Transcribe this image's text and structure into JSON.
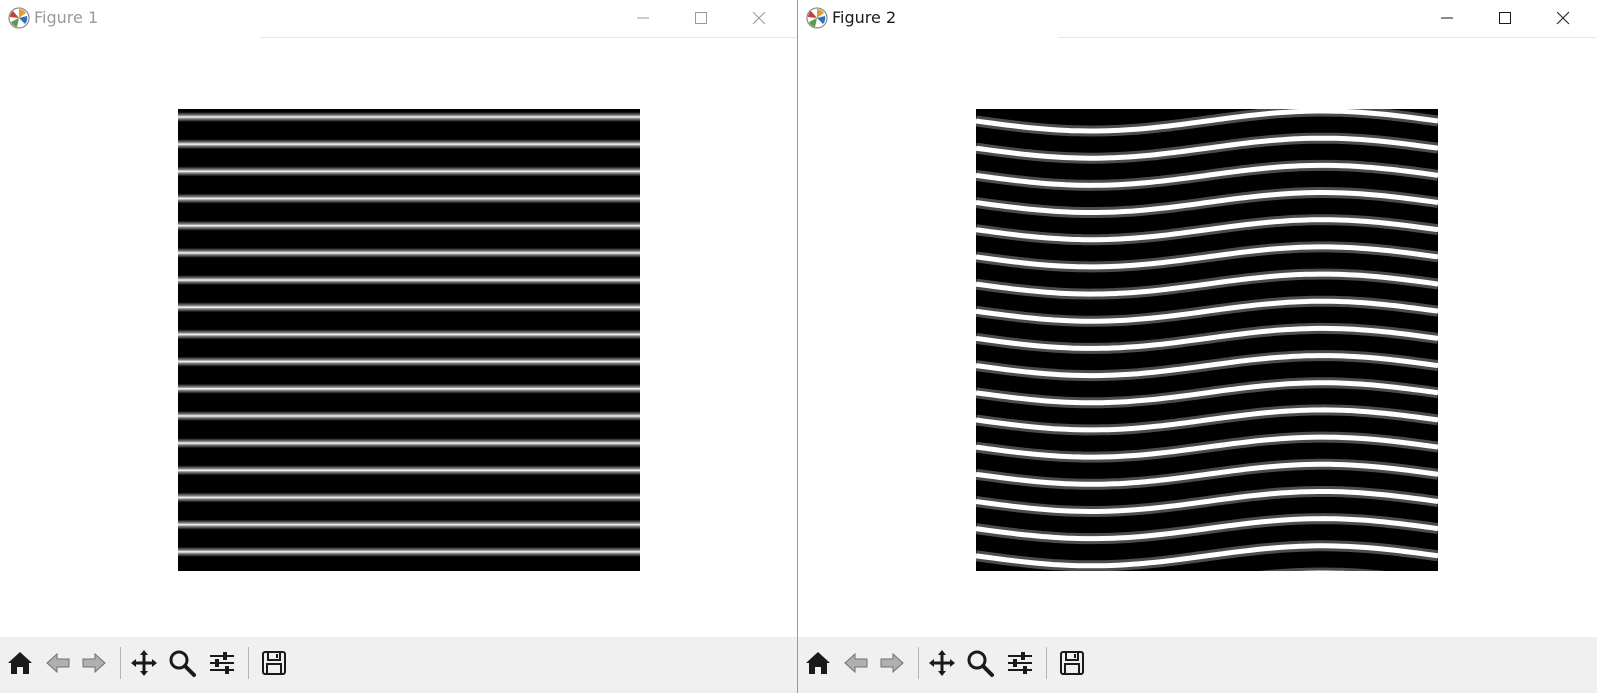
{
  "windows": [
    {
      "title": "Figure 1",
      "active": false,
      "image": {
        "kind": "straight-stripes",
        "stripe_count": 17
      }
    },
    {
      "title": "Figure 2",
      "active": true,
      "image": {
        "kind": "wavy-stripes",
        "stripe_count": 17
      }
    }
  ],
  "window_controls": [
    "minimize-icon",
    "maximize-icon",
    "close-icon"
  ],
  "toolbar_icons": [
    "home-icon",
    "back-icon",
    "forward-icon",
    "pan-icon",
    "zoom-icon",
    "subplots-config-icon",
    "save-icon"
  ],
  "colors": {
    "title_inactive": "#9a9a9a",
    "title_active": "#1a1a1a",
    "toolbar_bg": "#f0f0f0",
    "stripe_dark": "#000000",
    "stripe_light": "#ffffff"
  }
}
